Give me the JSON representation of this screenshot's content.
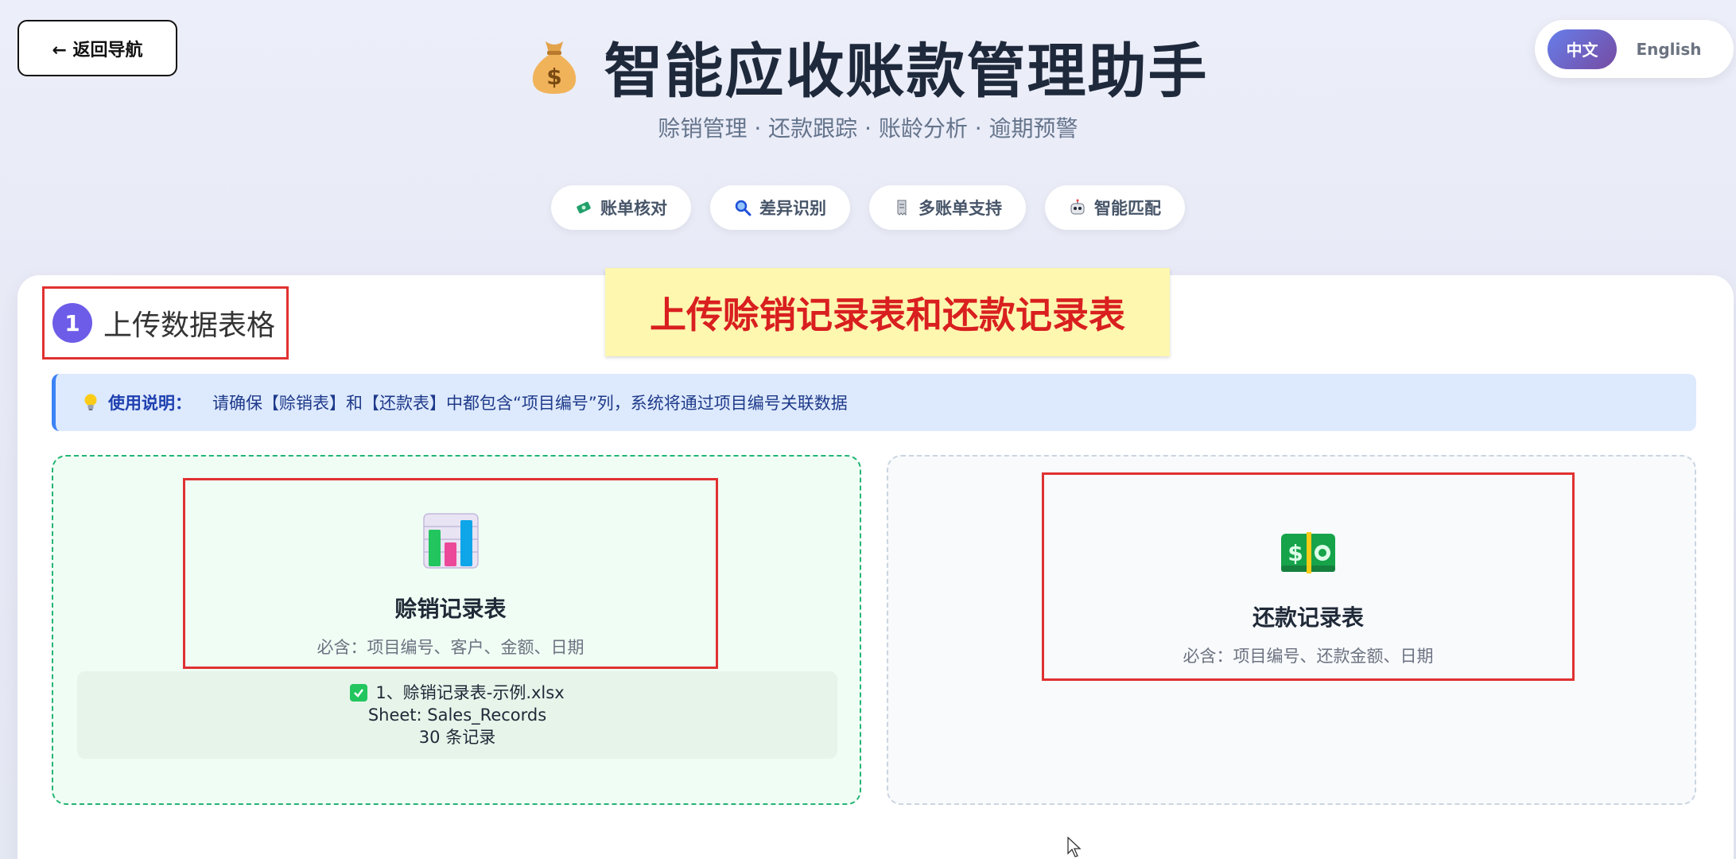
{
  "nav": {
    "back_label": "← 返回导航"
  },
  "lang": {
    "zh_label": "中文",
    "en_label": "English"
  },
  "header": {
    "title": "智能应收账款管理助手",
    "subtitle": "赊销管理 · 还款跟踪 · 账龄分析 · 逾期预警",
    "icon": "money-bag-icon"
  },
  "features": [
    {
      "label": "账单核对",
      "icon": "money-stack-icon"
    },
    {
      "label": "差异识别",
      "icon": "magnifier-icon"
    },
    {
      "label": "多账单支持",
      "icon": "receipt-icon"
    },
    {
      "label": "智能匹配",
      "icon": "robot-icon"
    }
  ],
  "step": {
    "number": "1",
    "title": "上传数据表格"
  },
  "annotation": {
    "text": "上传赊销记录表和还款记录表"
  },
  "tip": {
    "label": "使用说明：",
    "text": "请确保【赊销表】和【还款表】中都包含“项目编号”列，系统将通过项目编号关联数据"
  },
  "upload_sales": {
    "title": "赊销记录表",
    "required": "必含：项目编号、客户、金额、日期",
    "file_name": "1、赊销记录表-示例.xlsx",
    "sheet": "Sheet: Sales_Records",
    "count": "30 条记录",
    "icon": "bar-chart-icon"
  },
  "upload_payment": {
    "title": "还款记录表",
    "required": "必含：项目编号、还款金额、日期",
    "icon": "dollar-bill-icon"
  },
  "colors": {
    "accent": "#6d5ce8",
    "annotation_red": "#d91f1f",
    "success_green": "#22b573",
    "tip_blue": "#3b82f6"
  }
}
